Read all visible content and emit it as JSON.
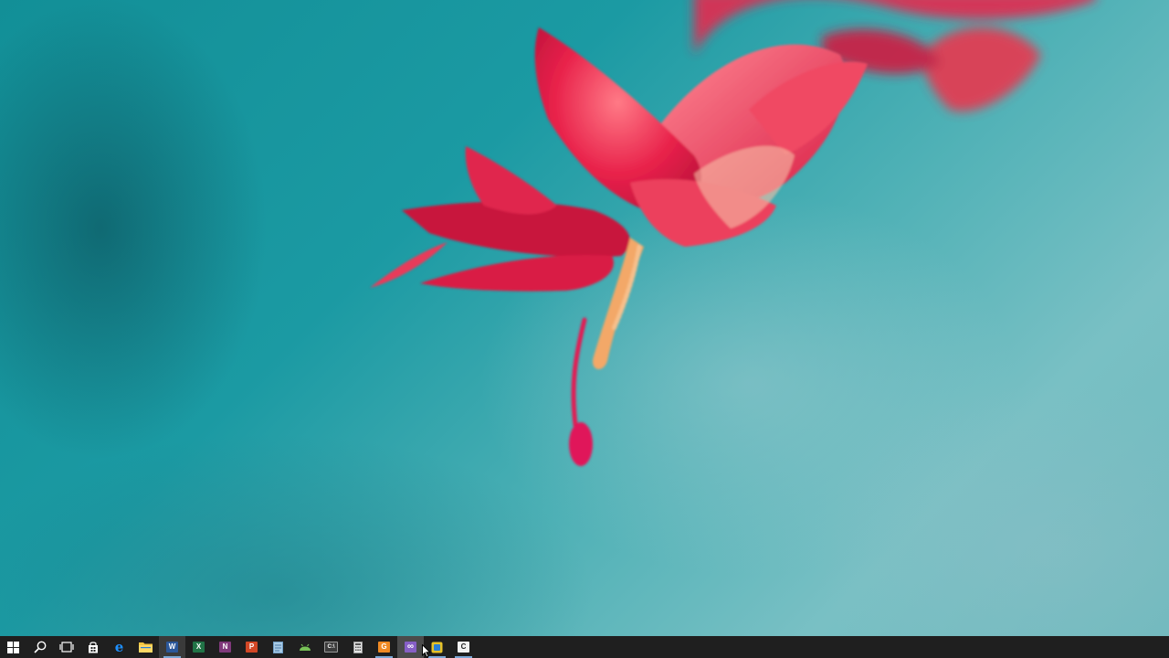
{
  "desktop": {
    "wallpaper_colors": {
      "background": "#1b9aa3",
      "petal": "#e8214a",
      "petal_light": "#ff6b7d",
      "stamen": "#f0a35c"
    }
  },
  "taskbar": {
    "background": "#1f1f1f",
    "items": [
      {
        "name": "start-button",
        "icon": "windows-logo-icon",
        "color": "#ffffff",
        "glyph": "",
        "running": false
      },
      {
        "name": "search-button",
        "icon": "search-icon",
        "color": "#ffffff",
        "glyph": "",
        "running": false
      },
      {
        "name": "task-view-button",
        "icon": "task-view-icon",
        "color": "#ffffff",
        "glyph": "",
        "running": false
      },
      {
        "name": "store-button",
        "icon": "store-bag-icon",
        "color": "#ffffff",
        "glyph": "",
        "running": false
      },
      {
        "name": "edge-button",
        "icon": "edge-icon",
        "color": "#1e90ff",
        "glyph": "e",
        "running": false
      },
      {
        "name": "file-explorer-button",
        "icon": "folder-icon",
        "color": "#f4c542",
        "glyph": "",
        "running": false
      },
      {
        "name": "word-button",
        "icon": "word-icon",
        "color": "#2b579a",
        "glyph": "W",
        "running": true
      },
      {
        "name": "excel-button",
        "icon": "excel-icon",
        "color": "#217346",
        "glyph": "X",
        "running": false
      },
      {
        "name": "onenote-button",
        "icon": "onenote-icon",
        "color": "#80397b",
        "glyph": "N",
        "running": false
      },
      {
        "name": "powerpoint-button",
        "icon": "powerpoint-icon",
        "color": "#d24726",
        "glyph": "P",
        "running": false
      },
      {
        "name": "notepad-button",
        "icon": "notepad-icon",
        "color": "#8fb8d8",
        "glyph": "",
        "running": false
      },
      {
        "name": "android-button",
        "icon": "android-icon",
        "color": "#78c257",
        "glyph": "",
        "running": false
      },
      {
        "name": "command-prompt-button",
        "icon": "terminal-icon",
        "color": "#3c3c3c",
        "glyph": "C:\\",
        "running": false
      },
      {
        "name": "calculator-button",
        "icon": "calculator-icon",
        "color": "#e6e6e6",
        "glyph": "",
        "running": false
      },
      {
        "name": "app-g-button",
        "icon": "orange-app-icon",
        "color": "#f08a24",
        "glyph": "G",
        "running": true
      },
      {
        "name": "visual-studio-button",
        "icon": "visual-studio-icon",
        "color": "#865fc5",
        "glyph": "∞",
        "running": false,
        "highlight": true
      },
      {
        "name": "app-yellow-button",
        "icon": "yellow-app-icon",
        "color": "#e6c229",
        "glyph": "",
        "running": true
      },
      {
        "name": "app-c-button",
        "icon": "c-app-icon",
        "color": "#f2f2f2",
        "glyph": "C",
        "running": true
      }
    ]
  }
}
